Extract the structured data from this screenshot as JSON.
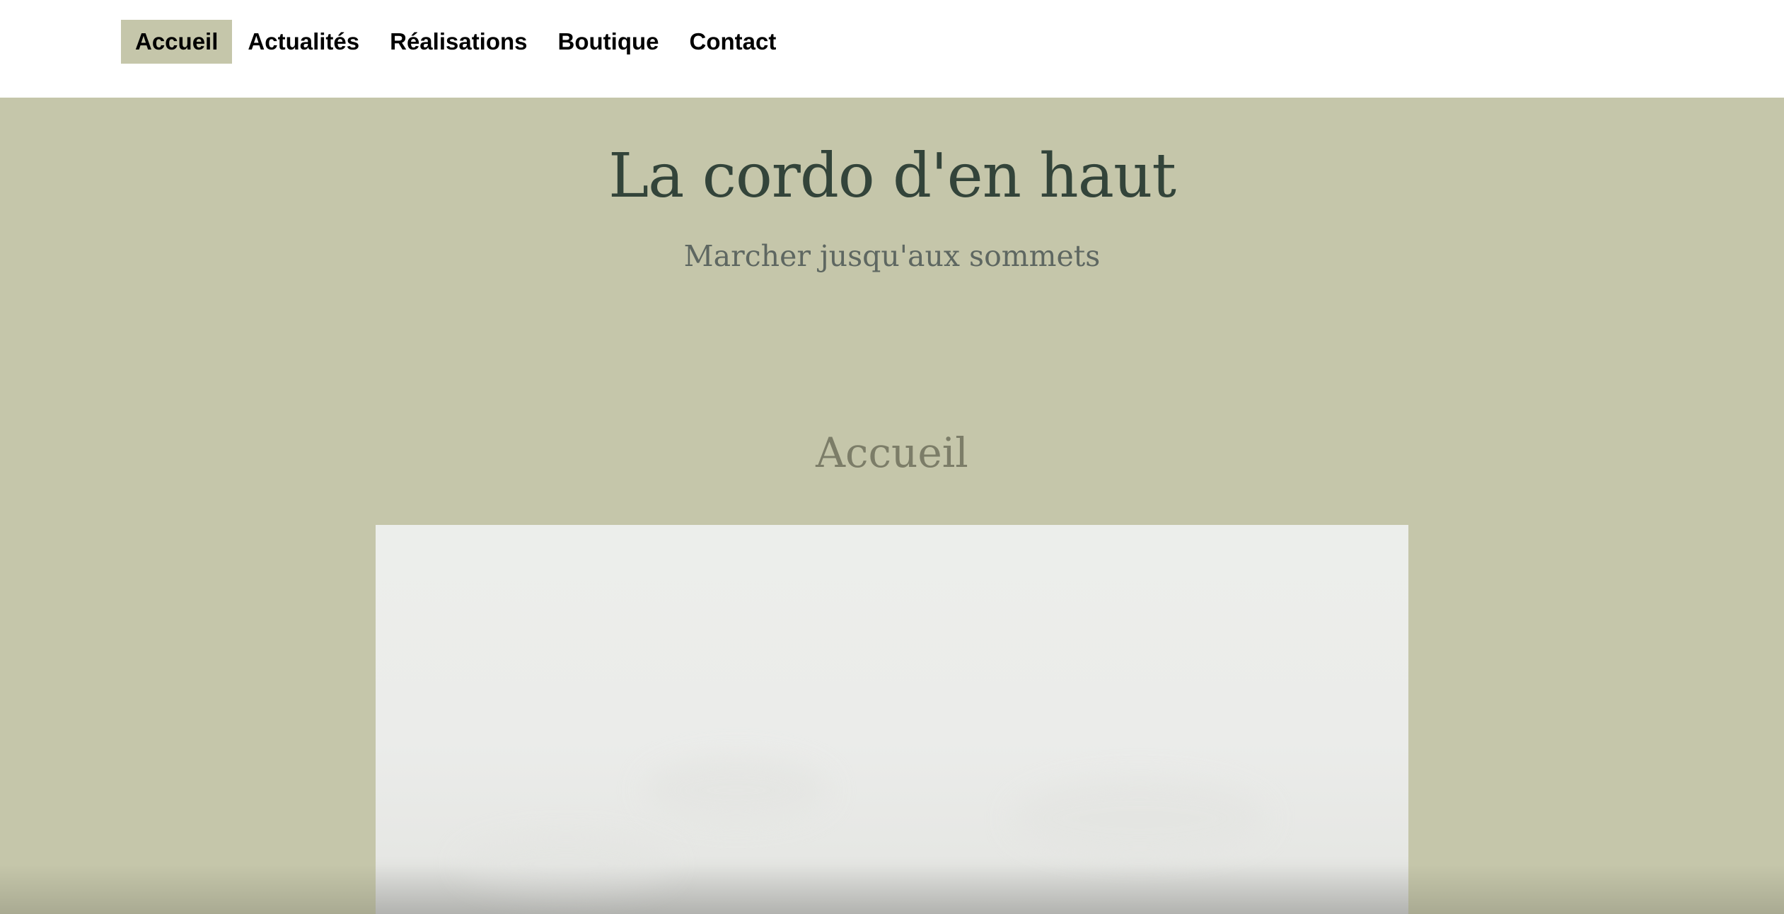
{
  "nav": {
    "items": [
      {
        "label": "Accueil",
        "active": true
      },
      {
        "label": "Actualités",
        "active": false
      },
      {
        "label": "Réalisations",
        "active": false
      },
      {
        "label": "Boutique",
        "active": false
      },
      {
        "label": "Contact",
        "active": false
      }
    ]
  },
  "header": {
    "title": "La cordo d'en haut",
    "tagline": "Marcher jusqu'aux sommets"
  },
  "main": {
    "heading": "Accueil"
  },
  "colors": {
    "background": "#c5c6aa",
    "title": "#33443a",
    "tagline": "#5e6761",
    "heading": "#7c7d68",
    "nav_active": "#c5c6aa"
  }
}
